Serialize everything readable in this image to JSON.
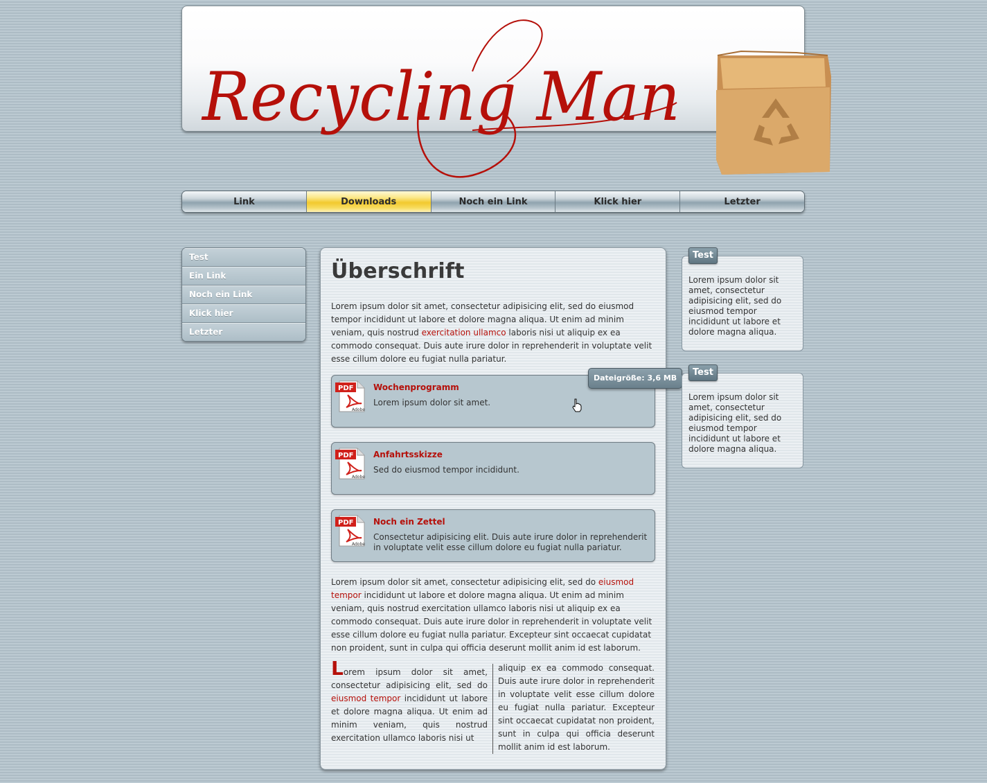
{
  "header": {
    "logo_text": "Recycling Man",
    "logo_color": "#b5100a"
  },
  "nav": {
    "items": [
      "Link",
      "Downloads",
      "Noch ein Link",
      "Klick hier",
      "Letzter"
    ],
    "active": "Downloads"
  },
  "sidebar_menu": {
    "items": [
      "Test",
      "Ein Link",
      "Noch ein Link",
      "Klick hier",
      "Letzter"
    ]
  },
  "main": {
    "title": "Überschrift",
    "intro": {
      "part1": "Lorem ipsum dolor sit amet, consectetur adipisicing elit, sed do eiusmod tempor incididunt ut labore et dolore magna aliqua. Ut enim ad minim veniam, quis nostrud ",
      "link": "exercitation ullamco",
      "part2": " laboris nisi ut aliquip ex ea commodo consequat. Duis aute irure dolor in reprehenderit in voluptate velit esse cillum dolore eu fugiat nulla pariatur."
    },
    "downloads": [
      {
        "title": "Wochenprogramm",
        "description": "Lorem ipsum dolor sit amet.",
        "icon": "pdf-icon"
      },
      {
        "title": "Anfahrtsskizze",
        "description": "Sed do eiusmod tempor incididunt.",
        "icon": "pdf-icon"
      },
      {
        "title": "Noch ein Zettel",
        "description": "Consectetur adipisicing elit. Duis aute irure dolor in reprehenderit in voluptate velit esse cillum dolore eu fugiat nulla pariatur.",
        "icon": "pdf-icon"
      }
    ],
    "tooltip": "Dateigröße: 3,6 MB",
    "para2": {
      "part1": "Lorem ipsum dolor sit amet, consectetur adipisicing elit, sed do ",
      "link": "eiusmod tempor",
      "part2": " incididunt ut labore et dolore magna aliqua. Ut enim ad minim veniam, quis nostrud exercitation ullamco laboris nisi ut aliquip ex ea commodo consequat. Duis aute irure dolor in reprehenderit in voluptate velit esse cillum dolore eu fugiat nulla pariatur. Excepteur sint occaecat cupidatat non proident, sunt in culpa qui officia deserunt mollit anim id est laborum."
    },
    "columns": {
      "dropcap": "L",
      "col1_part1": "orem ipsum dolor sit amet, consectetur adipisicing elit, sed do ",
      "col1_link": "eiusmod tempor",
      "col1_part2": " incididunt ut labore et dolore magna aliqua. Ut enim ad minim veniam, quis nostrud exercitation ullamco laboris nisi ut",
      "col2": "aliquip ex ea commodo consequat. Duis aute irure dolor in reprehenderit in voluptate velit esse cillum dolore eu fugiat nulla pariatur. Excepteur sint occaecat cupidatat non proident, sunt in culpa qui officia deserunt mollit anim id est laborum."
    }
  },
  "side_boxes": [
    {
      "title": "Test",
      "text": "Lorem ipsum dolor sit amet, consectetur adipisicing elit, sed do eiusmod tempor incididunt ut labore et dolore magna aliqua."
    },
    {
      "title": "Test",
      "text": "Lorem ipsum dolor sit amet, consectetur adipisicing elit, sed do eiusmod tempor incididunt ut labore et dolore magna aliqua."
    }
  ],
  "colors": {
    "accent_red": "#b5100a",
    "nav_active": "#f2c92e",
    "background": "#b9c8d0"
  }
}
